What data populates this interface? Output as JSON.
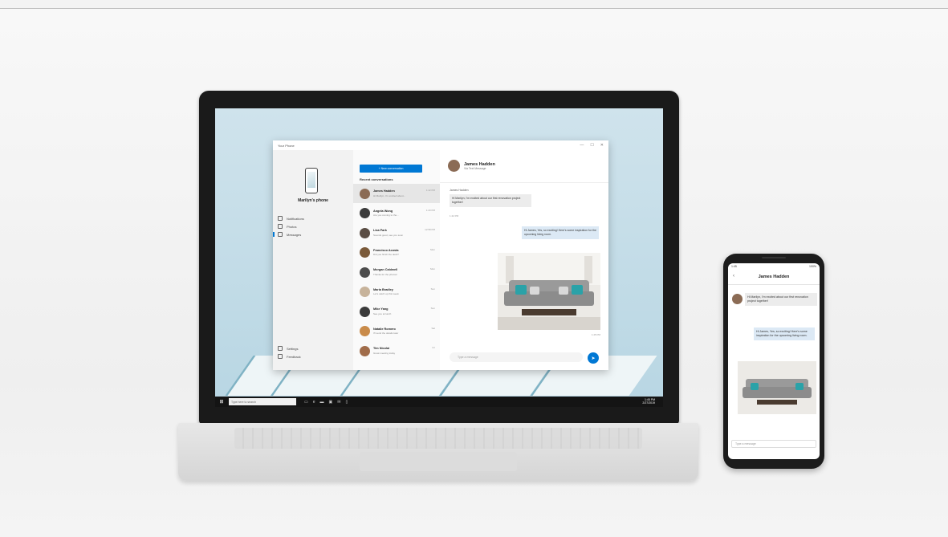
{
  "app": {
    "title": "Your Phone",
    "window_controls": [
      "—",
      "☐",
      "✕"
    ]
  },
  "left_pane": {
    "device_name": "Marilyn's phone",
    "nav": [
      {
        "label": "Notifications",
        "icon": "bell-icon"
      },
      {
        "label": "Photos",
        "icon": "photo-icon"
      },
      {
        "label": "Messages",
        "icon": "message-icon"
      }
    ],
    "footer": [
      {
        "label": "Settings",
        "icon": "gear-icon"
      },
      {
        "label": "Feedback",
        "icon": "feedback-icon"
      }
    ]
  },
  "conversations": {
    "new_button": "+ New conversation",
    "header": "Recent conversations",
    "items": [
      {
        "name": "James Hadden",
        "preview": "Hi Marilyn, I'm excited about...",
        "time": "1:42 PM",
        "color": "#8b6b55"
      },
      {
        "name": "Angela Wong",
        "preview": "Are you coming to the...",
        "time": "1:20 PM",
        "color": "#3b3b3b"
      },
      {
        "name": "Lisa Park",
        "preview": "Sounds good, see you soon",
        "time": "12:58 PM",
        "color": "#5a4d44"
      },
      {
        "name": "Francisco Acosta",
        "preview": "Did you finish the deck?",
        "time": "Mon",
        "color": "#7a5a3a"
      },
      {
        "name": "Morgan Caldwell",
        "preview": "Thanks for the photos!",
        "time": "Mon",
        "color": "#4d4d4d"
      },
      {
        "name": "Maria Bradley",
        "preview": "Let's catch up this week",
        "time": "Sun",
        "color": "#c7b39b"
      },
      {
        "name": "Mike Yang",
        "preview": "See you at lunch",
        "time": "Sun",
        "color": "#3a3a3a"
      },
      {
        "name": "Natalie Romero",
        "preview": "I'll send the details later",
        "time": "Sat",
        "color": "#c98b4a"
      },
      {
        "name": "Tim Nicolai",
        "preview": "Great meeting today",
        "time": "Fri",
        "color": "#a06c4a"
      }
    ]
  },
  "chat": {
    "name": "James Hadden",
    "subtitle": "Via Text Message",
    "incoming_sender": "James Hadden",
    "incoming": "Hi Marilyn, I'm excited about our first renovation project together!",
    "incoming_time": "1:42 PM",
    "outgoing": "Hi James, Yes, so exciting! Here's some inspiration for the upcoming living room.",
    "photo_time": "1:45 PM",
    "compose_placeholder": "Type a message",
    "send_icon": "send-icon"
  },
  "taskbar": {
    "search_placeholder": "Type here to search",
    "clock_time": "1:45 PM",
    "clock_date": "2/27/2019"
  },
  "phone": {
    "status_time": "1:45",
    "status_right": "100%",
    "title": "James Hadden",
    "incoming": "Hi Marilyn, I'm excited about our first renovation project together!",
    "outgoing": "Hi James, Yes, so exciting! Here's some inspiration for the upcoming living room.",
    "compose_placeholder": "Type a message"
  }
}
